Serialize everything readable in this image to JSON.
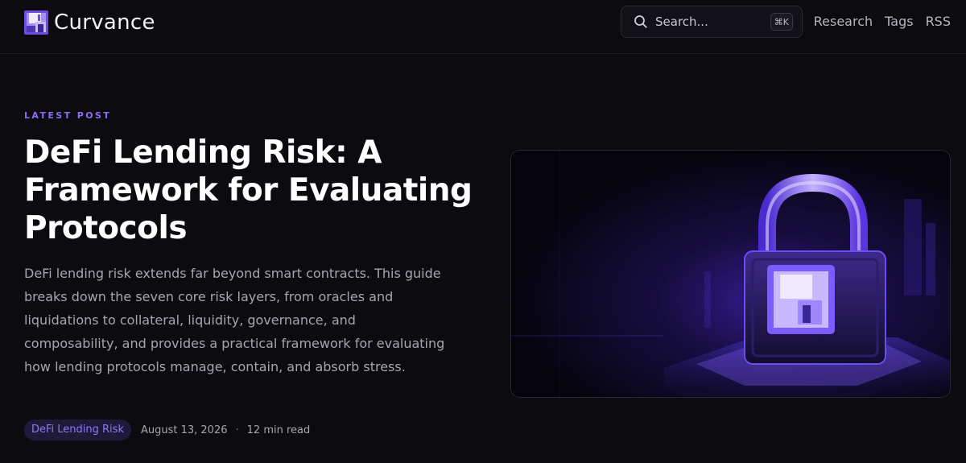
{
  "header": {
    "brand_name": "Curvance",
    "search": {
      "placeholder": "Search...",
      "shortcut": "⌘K"
    },
    "nav": [
      {
        "label": "Research"
      },
      {
        "label": "Tags"
      },
      {
        "label": "RSS"
      }
    ]
  },
  "hero": {
    "eyebrow": "LATEST POST",
    "title": "DeFi Lending Risk: A Framework for Evaluating Protocols",
    "excerpt": "DeFi lending risk extends far beyond smart contracts. This guide breaks down the seven core risk layers, from oracles and liquidations to collateral, liquidity, governance, and composability, and provides a practical framework for evaluating how lending protocols manage, contain, and absorb stress.",
    "tag": "DeFi Lending Risk",
    "date": "August 13, 2026",
    "separator": "·",
    "read_time": "12 min read",
    "image_icon": "padlock-icon"
  },
  "colors": {
    "background": "#0c0b0f",
    "accent": "#8b6cf5",
    "tag_bg": "#1f1a3a"
  }
}
